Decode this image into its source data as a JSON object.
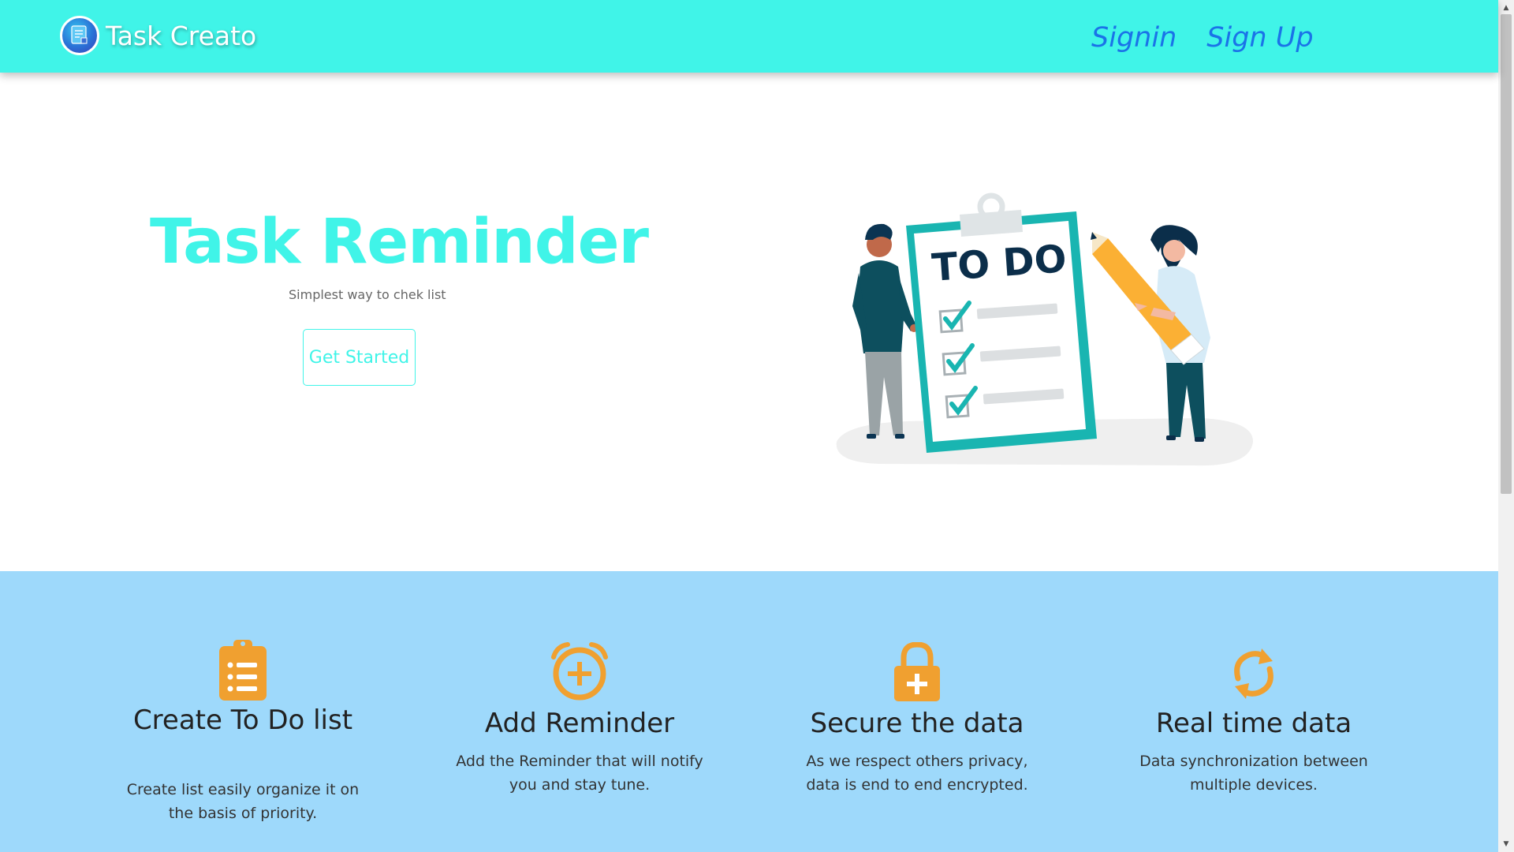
{
  "navbar": {
    "brand_name": "Task Creato",
    "signin_label": "Signin",
    "signup_label": "Sign Up"
  },
  "hero": {
    "title": "Task Reminder",
    "subtitle": "Simplest way to chek list",
    "cta_label": "Get Started",
    "illustration_text": "TO DO"
  },
  "features": [
    {
      "icon": "clipboard-list-icon",
      "title": "Create To Do list",
      "description": "Create list easily organize it on the basis of priority."
    },
    {
      "icon": "alarm-clock-plus-icon",
      "title": "Add Reminder",
      "description": "Add the Reminder that will notify you and stay tune."
    },
    {
      "icon": "lock-plus-icon",
      "title": "Secure the data",
      "description": "As we respect others privacy, data is end to end encrypted."
    },
    {
      "icon": "sync-icon",
      "title": "Real time data",
      "description": "Data synchronization between multiple devices."
    }
  ],
  "colors": {
    "navbar_bg": "#40f4e8",
    "accent": "#40f4e8",
    "nav_link": "#1a73e8",
    "features_bg": "#9ed9fb",
    "feature_icon": "#f0a030"
  }
}
